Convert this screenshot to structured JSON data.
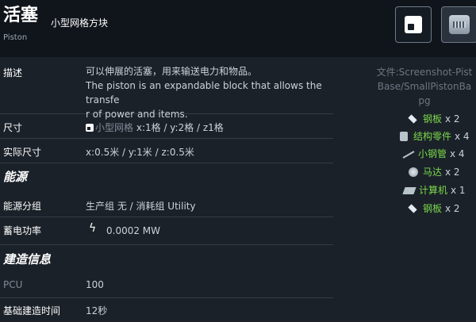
{
  "header": {
    "title": "活塞",
    "subtitle_cn": "小型网格方块",
    "subtitle_en": "Piston"
  },
  "rows": {
    "description": {
      "label": "描述",
      "line1": "可以伸展的活塞，用来输送电力和物品。",
      "line2": "The piston is an expandable block that allows the transfe",
      "line3": "r of power and items."
    },
    "size": {
      "label": "尺寸",
      "grid": "小型网格",
      "value": "x:1格 / y:2格 / z1格"
    },
    "actual_size": {
      "label": "实际尺寸",
      "value": "x:0.5米 / y:1米 / z:0.5米"
    }
  },
  "energy": {
    "section": "能源",
    "group": {
      "label": "能源分组",
      "value": "生产组 无 / 消耗组 Utility"
    },
    "storage": {
      "label": "蓄电功率",
      "icon": "lightning-icon",
      "value": "0.0002 MW"
    }
  },
  "build": {
    "section": "建造信息",
    "pcu": {
      "label": "PCU",
      "value": "100"
    },
    "time": {
      "label": "基础建造时间",
      "value": "12秒"
    }
  },
  "file": {
    "text": "文件:Screenshot-Pist\nBase/SmallPistonBa\npg"
  },
  "components": [
    {
      "icon": "steel-plate-icon",
      "name": "钢板",
      "qty": "x 2"
    },
    {
      "icon": "construction-component-icon",
      "name": "结构零件",
      "qty": "x 4"
    },
    {
      "icon": "small-steel-tube-icon",
      "name": "小钢管",
      "qty": "x 4"
    },
    {
      "icon": "motor-icon",
      "name": "马达",
      "qty": "x 2"
    },
    {
      "icon": "computer-icon",
      "name": "计算机",
      "qty": "x 1"
    },
    {
      "icon": "steel-plate-icon",
      "name": "钢板",
      "qty": "x 2"
    }
  ]
}
